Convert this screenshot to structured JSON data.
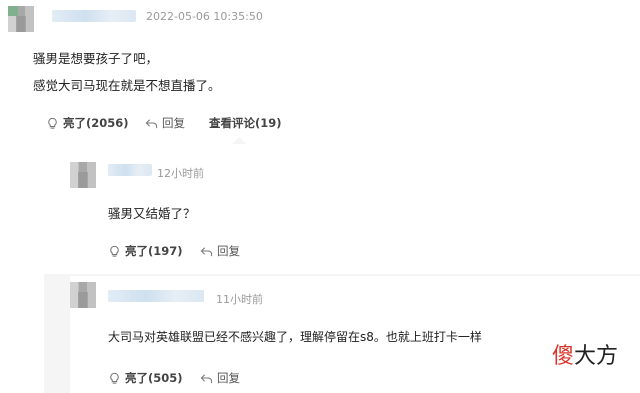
{
  "comment": {
    "timestamp": "2022-05-06 10:35:50",
    "lines": [
      "骚男是想要孩子了吧，",
      "感觉大司马现在就是不想直播了。"
    ],
    "like_label": "亮了(2056)",
    "reply_label": "回复",
    "view_replies_label": "查看评论(19)"
  },
  "replies": [
    {
      "time": "12小时前",
      "text": "骚男又结婚了？",
      "like_label": "亮了(197)",
      "reply_label": "回复"
    },
    {
      "time": "11小时前",
      "text": "大司马对英雄联盟已经不感兴趣了，理解停留在s8。也就上班打卡一样",
      "like_label": "亮了(505)",
      "reply_label": "回复"
    }
  ],
  "watermark": {
    "part1": "傻",
    "part2": "大方"
  },
  "icons": {
    "like": "lightbulb-icon",
    "reply": "reply-arrow-icon"
  },
  "colors": {
    "watermark_red": "#d9362b",
    "muted": "#9a9a9a"
  }
}
